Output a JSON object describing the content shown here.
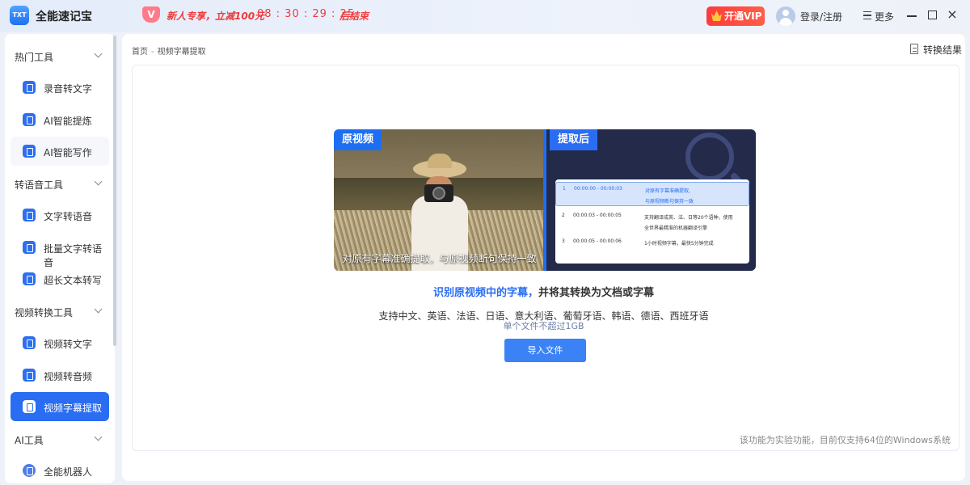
{
  "app": {
    "name": "全能速记宝",
    "logo_text": "TXT"
  },
  "promo": {
    "badge": "V",
    "text": "新人专享，立减100元",
    "timer": "08 : 30 : 29 : 25",
    "ends": "后结束"
  },
  "header": {
    "vip": "开通VIP",
    "login": "登录/注册",
    "more": "更多"
  },
  "sidebar": {
    "groups": [
      {
        "title": "热门工具",
        "items": [
          "录音转文字",
          "AI智能提炼",
          "AI智能写作"
        ]
      },
      {
        "title": "转语音工具",
        "items": [
          "文字转语音",
          "批量文字转语音",
          "超长文本转写"
        ]
      },
      {
        "title": "视频转换工具",
        "items": [
          "视频转文字",
          "视频转音频",
          "视频字幕提取"
        ]
      },
      {
        "title": "AI工具",
        "items": [
          "全能机器人"
        ]
      }
    ],
    "active": "视频字幕提取"
  },
  "breadcrumb": {
    "home": "首页",
    "sep": "-",
    "current": "视频字幕提取"
  },
  "result_button": "转换结果",
  "preview": {
    "tag_before": "原视频",
    "tag_after": "提取后",
    "photo_subtitle": "对原有字幕准确提取，与原视频断句保持一致",
    "subs": [
      {
        "n": "1",
        "time": "00:00:00  -  00:00:03",
        "text1": "对原有字幕准确提取,",
        "text2": "与原视频断句保持一致"
      },
      {
        "n": "2",
        "time": "00:00:03  -  00:00:05",
        "text1": "支持翻译成英、法、日等20个语种，使用",
        "text2": "全世界最精准的机器翻译引擎"
      },
      {
        "n": "3",
        "time": "00:00:05  -  00:00:06",
        "text1": "1小时视频字幕，最快5分钟完成",
        "text2": ""
      }
    ]
  },
  "headline": {
    "blue": "识别原视频中的字幕，",
    "dark": "并将其转换为文档或字幕"
  },
  "languages": "支持中文、英语、法语、日语、意大利语、葡萄牙语、韩语、德语、西班牙语",
  "limit": "单个文件不超过1GB",
  "import_button": "导入文件",
  "note": "该功能为实验功能，目前仅支持64位的Windows系统",
  "colors": {
    "accent": "#2a6df2",
    "promo": "#f03a3a",
    "vip": "#ff3b3b"
  }
}
